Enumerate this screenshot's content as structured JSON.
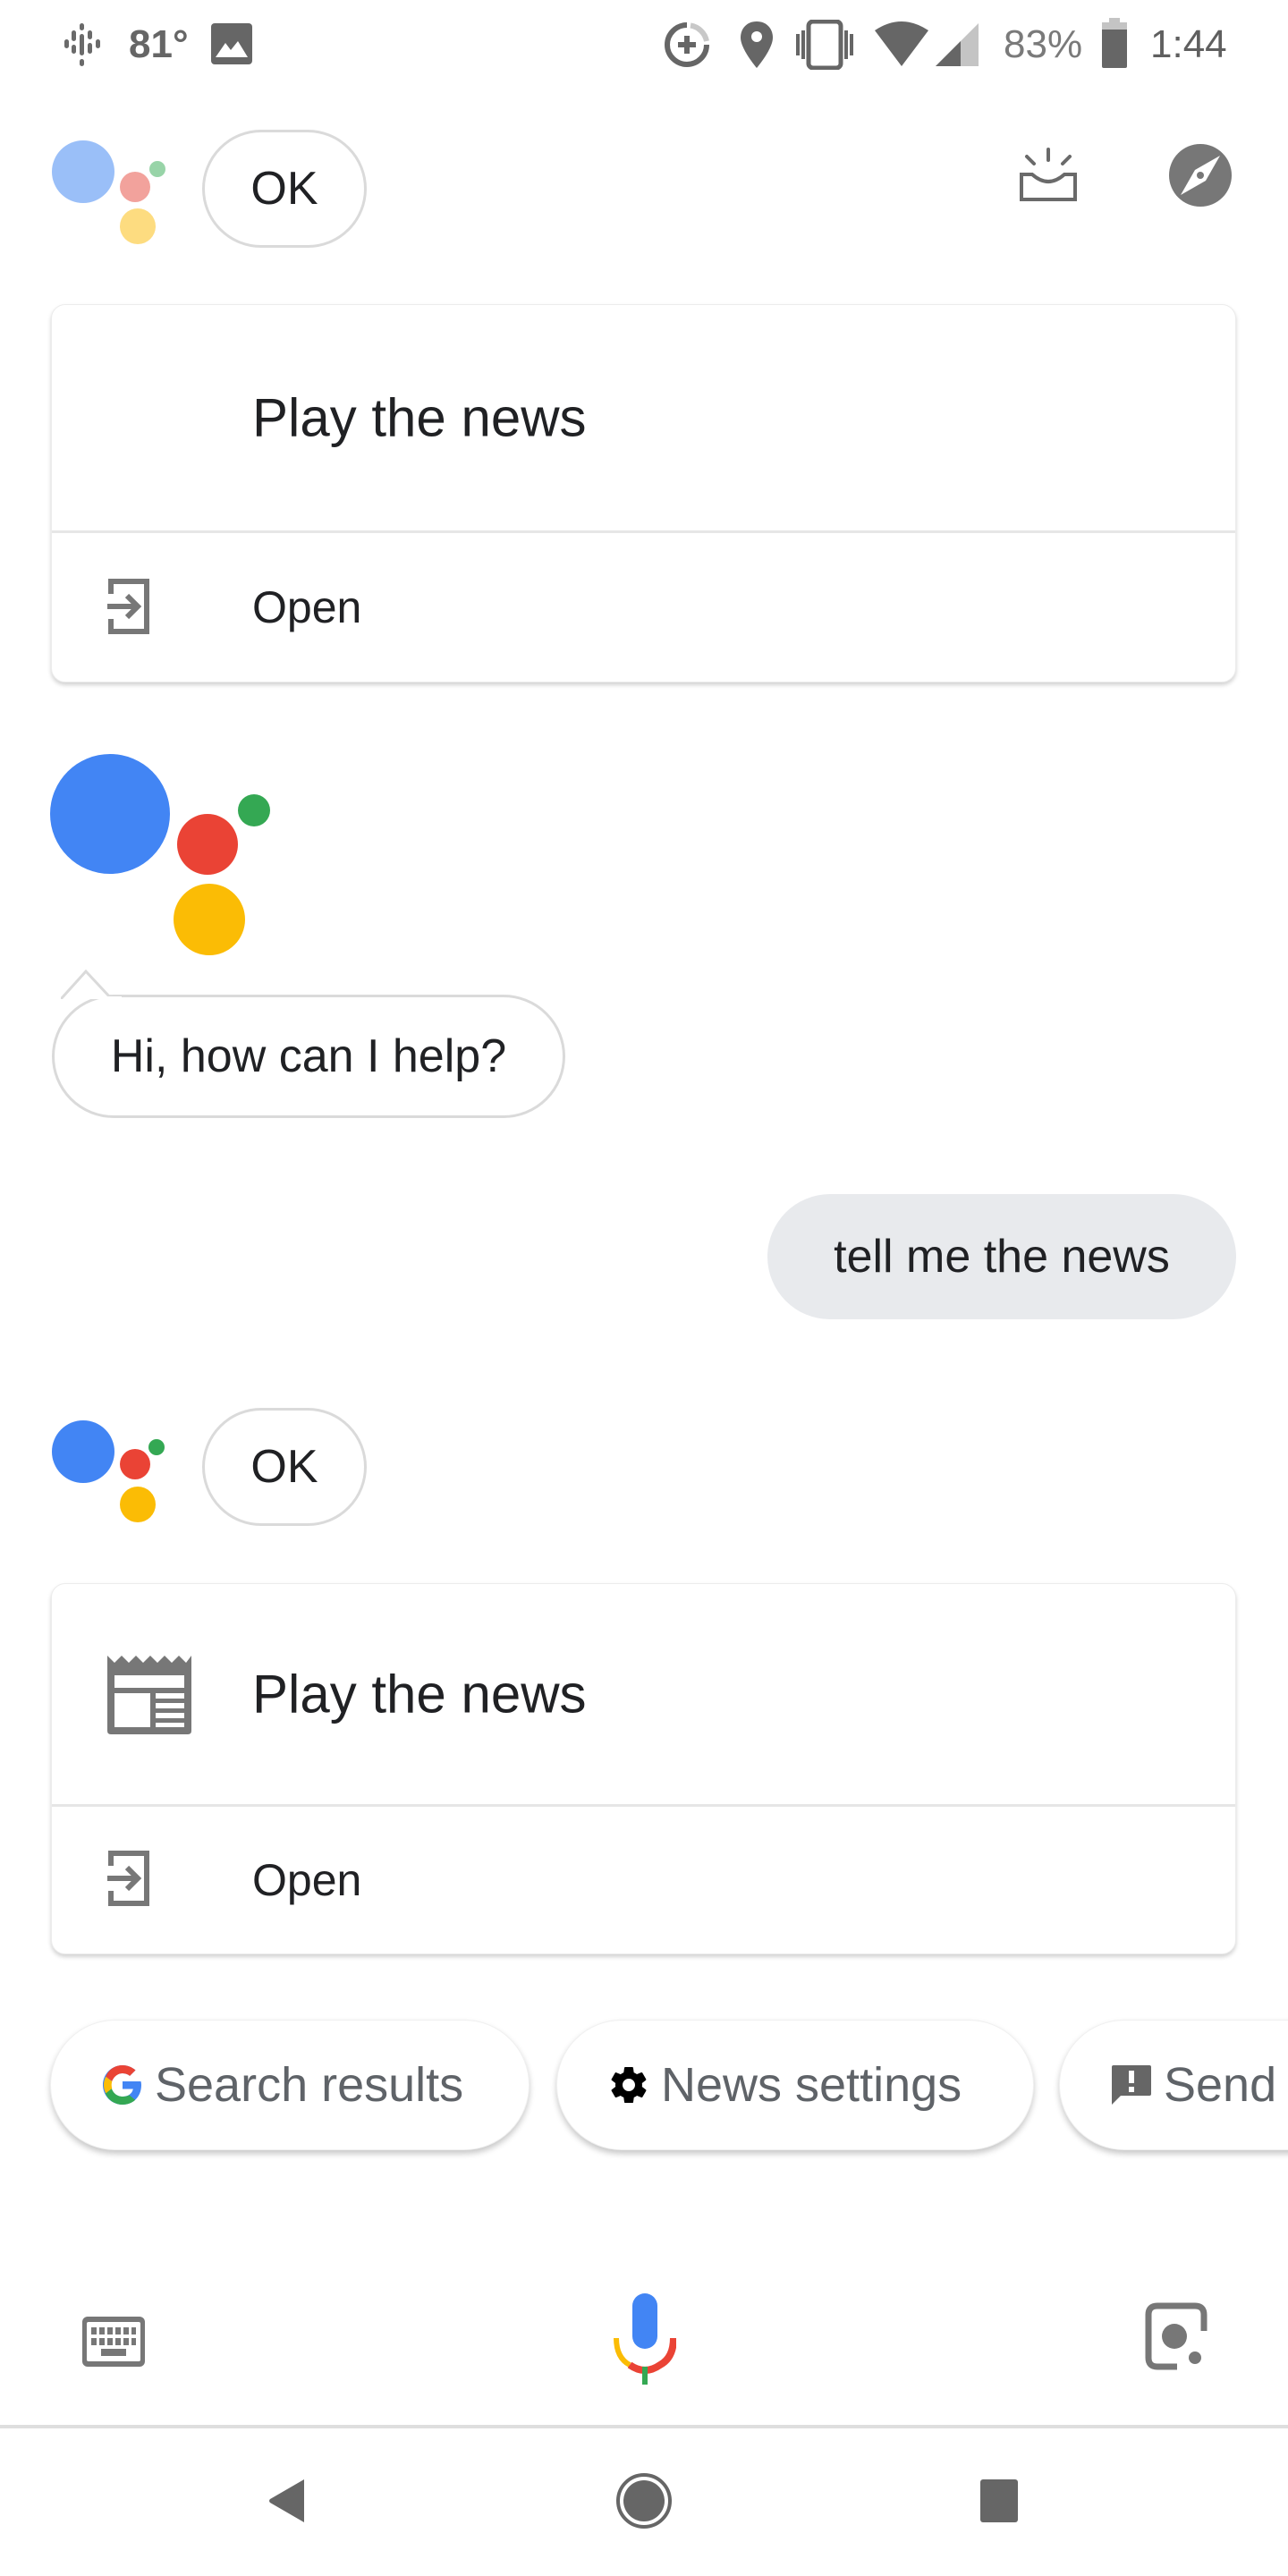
{
  "status_bar": {
    "weather_temp": "81°",
    "battery_percent": "83%",
    "time": "1:44",
    "icons": [
      "podcast-icon",
      "image-icon",
      "data-saver-icon",
      "location-icon",
      "vibrate-icon",
      "wifi-icon",
      "cell-signal-icon",
      "battery-icon"
    ],
    "battery_level": 0.83
  },
  "conversation": {
    "first_ok": "OK",
    "first_card": {
      "title": "Play the news",
      "open_label": "Open"
    },
    "greeting": "Hi, how can I help?",
    "user_query": "tell me the news",
    "second_ok": "OK",
    "second_card": {
      "title": "Play the news",
      "open_label": "Open",
      "icon": "newspaper-icon"
    }
  },
  "header_actions": {
    "snapshot_icon": "inbox-updates-icon",
    "explore_icon": "compass-icon"
  },
  "suggestion_chips": [
    {
      "label": "Search results",
      "icon": "google-g-icon"
    },
    {
      "label": "News settings",
      "icon": "gear-icon"
    },
    {
      "label": "Send",
      "icon": "feedback-icon"
    }
  ],
  "input_bar": {
    "keyboard_icon": "keyboard-icon",
    "mic_icon": "mic-icon",
    "lens_icon": "lens-icon"
  },
  "nav_bar": {
    "back": "back-icon",
    "home": "home-icon",
    "recents": "recents-icon"
  },
  "colors": {
    "blue": "#4285F4",
    "red": "#EA4335",
    "yellow": "#FBBC05",
    "green": "#34A853",
    "icon_gray": "#707070",
    "user_bubble": "#E8EAED"
  }
}
